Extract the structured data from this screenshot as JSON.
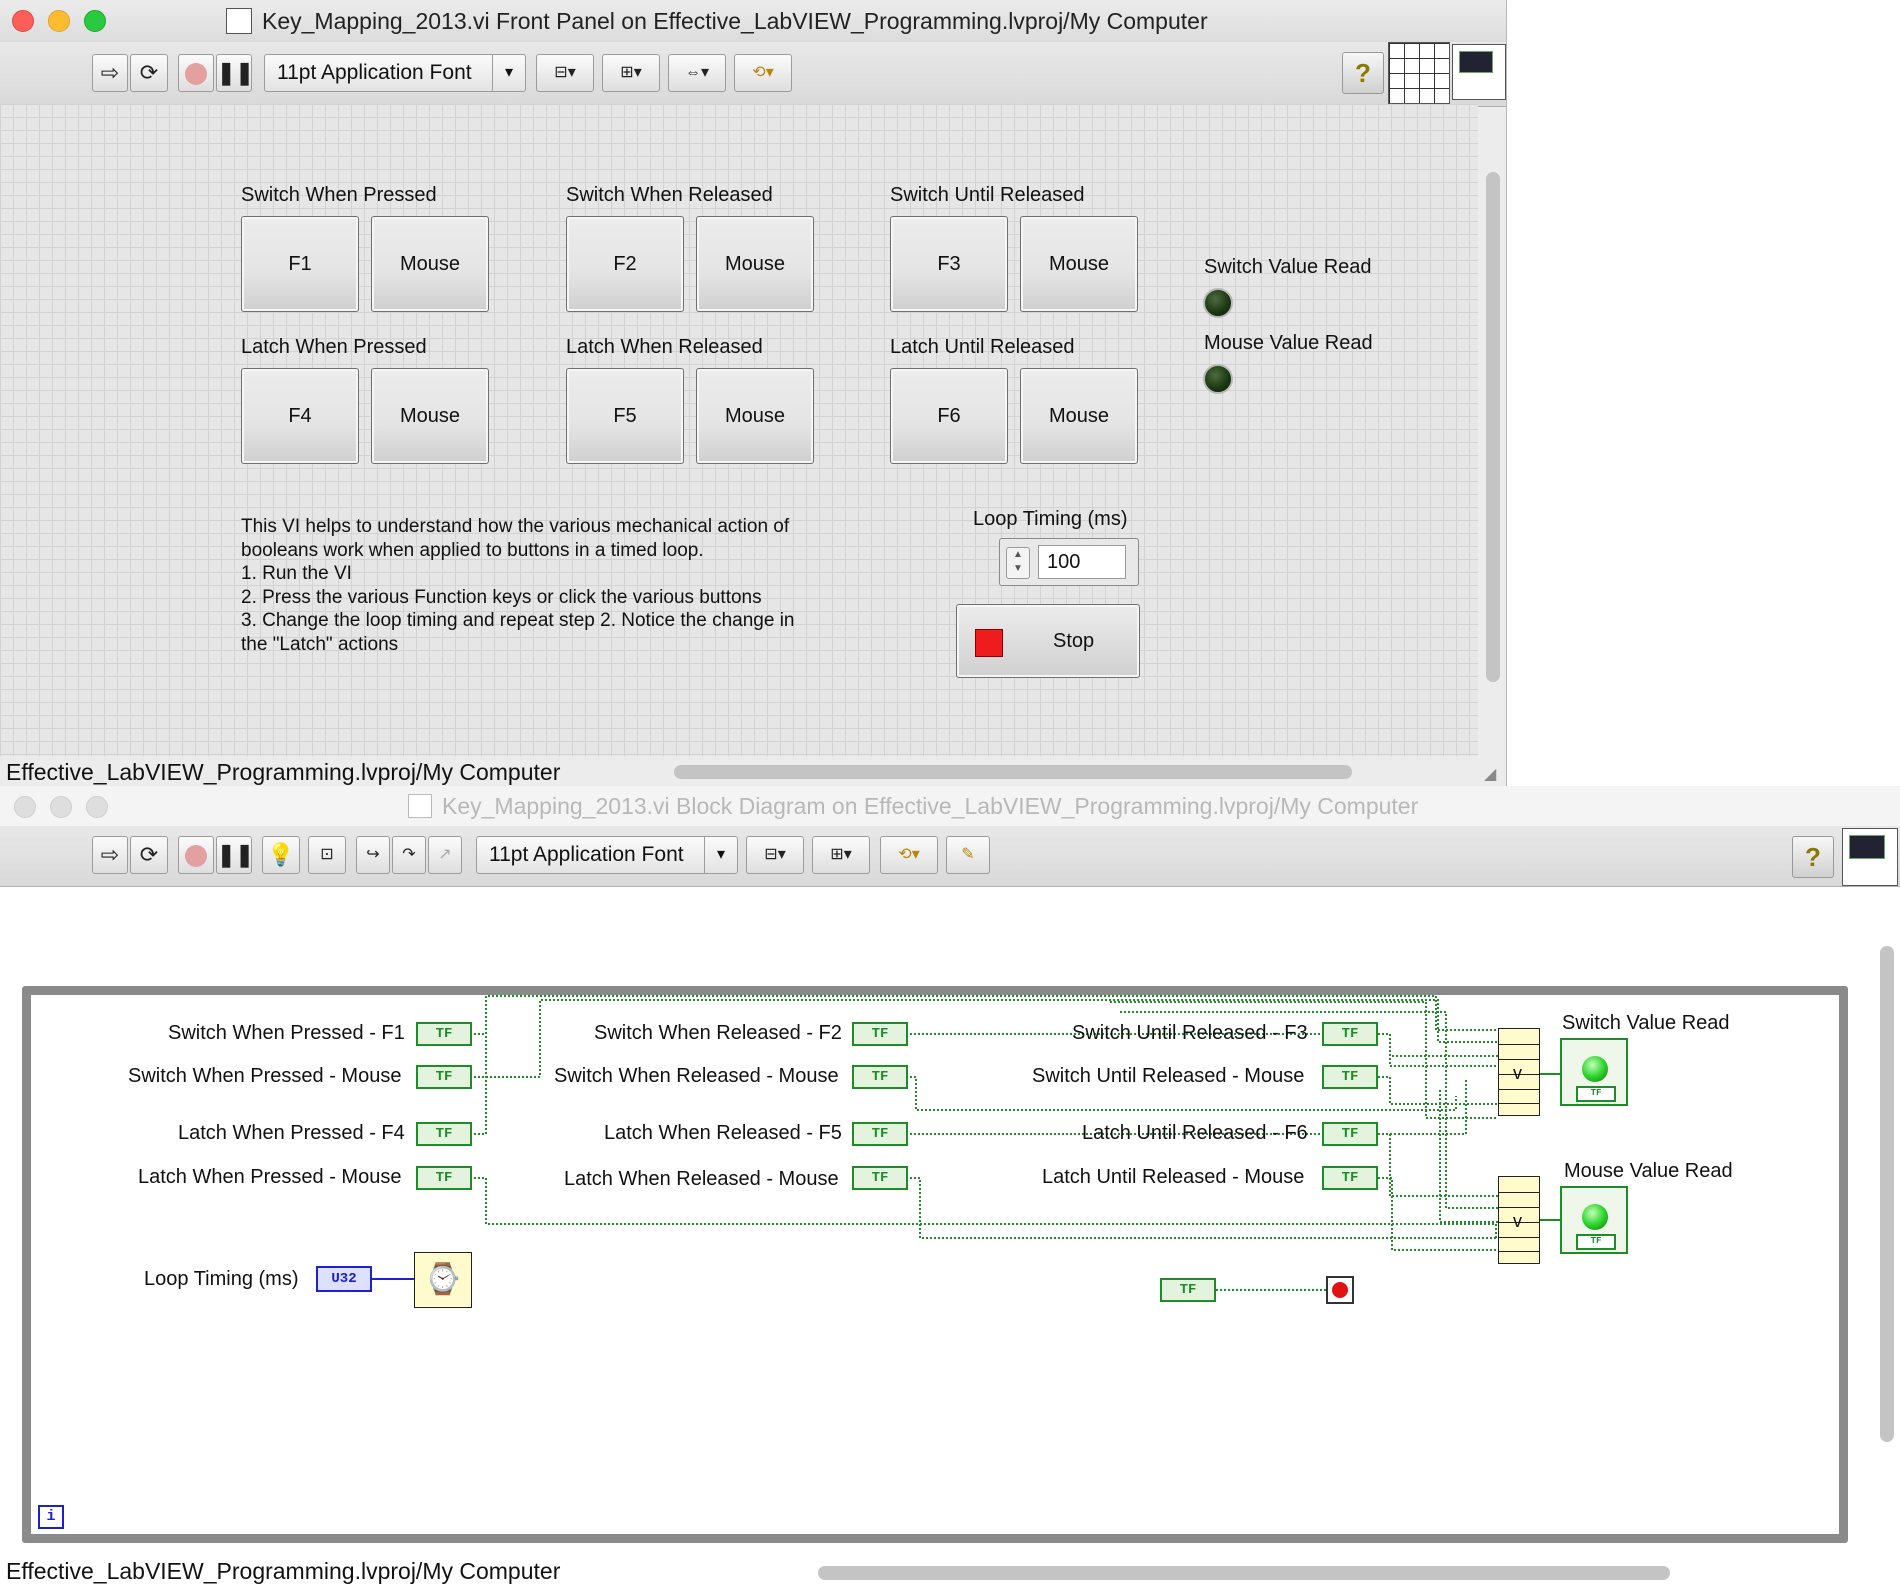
{
  "front_panel": {
    "title": "Key_Mapping_2013.vi Front Panel on Effective_LabVIEW_Programming.lvproj/My Computer",
    "font_menu": "11pt Application Font",
    "groups": [
      {
        "label": "Switch When Pressed",
        "key": "F1",
        "mouse": "Mouse"
      },
      {
        "label": "Switch When Released",
        "key": "F2",
        "mouse": "Mouse"
      },
      {
        "label": "Switch Until Released",
        "key": "F3",
        "mouse": "Mouse"
      },
      {
        "label": "Latch When Pressed",
        "key": "F4",
        "mouse": "Mouse"
      },
      {
        "label": "Latch When Released",
        "key": "F5",
        "mouse": "Mouse"
      },
      {
        "label": "Latch Until Released",
        "key": "F6",
        "mouse": "Mouse"
      }
    ],
    "indicators": {
      "switch": "Switch Value Read",
      "mouse": "Mouse Value Read"
    },
    "description": [
      "This VI helps to understand how the various mechanical action of",
      "booleans work when applied to buttons in a timed loop.",
      "1. Run the VI",
      "2. Press the various Function keys or click the various buttons",
      "3. Change the loop timing and repeat step 2. Notice the change in",
      "the \"Latch\" actions"
    ],
    "loop_timing": {
      "label": "Loop Timing (ms)",
      "value": "100"
    },
    "stop_label": "Stop",
    "status": "Effective_LabVIEW_Programming.lvproj/My Computer"
  },
  "block_diagram": {
    "title": "Key_Mapping_2013.vi Block Diagram on Effective_LabVIEW_Programming.lvproj/My Computer",
    "font_menu": "11pt Application Font",
    "terminals": [
      "Switch When Pressed - F1",
      "Switch When Pressed - Mouse",
      "Latch When Pressed - F4",
      "Latch When Pressed - Mouse",
      "Switch When Released - F2",
      "Switch When Released - Mouse",
      "Latch When Released - F5",
      "Latch When Released - Mouse",
      "Switch Until Released - F3",
      "Switch Until Released - Mouse",
      "Latch Until Released - F6",
      "Latch Until Released - Mouse"
    ],
    "bool_tag": "TF",
    "indicator_tag": "TF",
    "or_symbol": "v",
    "indicators": {
      "switch": "Switch Value Read",
      "mouse": "Mouse Value Read"
    },
    "loop_timing_label": "Loop Timing (ms)",
    "numeric_type": "U32",
    "iteration_label": "i",
    "status": "Effective_LabVIEW_Programming.lvproj/My Computer"
  },
  "colors": {
    "boolean_wire": "#1f8c28",
    "numeric_wire": "#1b23c8",
    "stop_red": "#ee1c1c"
  }
}
